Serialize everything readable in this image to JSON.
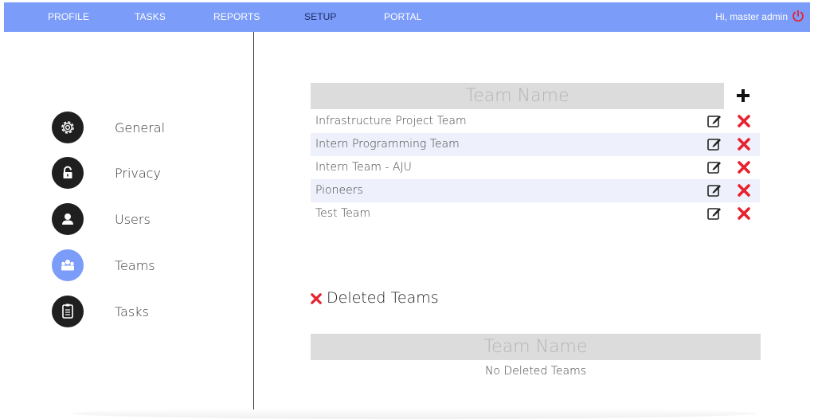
{
  "nav": {
    "items": [
      "PROFILE",
      "TASKS",
      "REPORTS",
      "SETUP",
      "PORTAL"
    ],
    "active": "SETUP",
    "greeting": "Hi, master admin",
    "power_icon": "power-icon",
    "bar_color": "#7b9cf8"
  },
  "sidebar": {
    "items": [
      {
        "label": "General",
        "icon": "gear-icon"
      },
      {
        "label": "Privacy",
        "icon": "lock-icon"
      },
      {
        "label": "Users",
        "icon": "user-icon"
      },
      {
        "label": "Teams",
        "icon": "team-icon"
      },
      {
        "label": "Tasks",
        "icon": "clipboard-icon"
      }
    ],
    "active": "Teams"
  },
  "teams": {
    "header": "Team Name",
    "rows": [
      "Infrastructure Project Team",
      "Intern Programming Team",
      "Intern Team - AJU",
      "Pioneers",
      "Test Team"
    ]
  },
  "deleted": {
    "heading": "Deleted Teams",
    "header": "Team Name",
    "empty_message": "No Deleted Teams"
  },
  "colors": {
    "delete": "#e8212e",
    "accent": "#7b9cf8"
  }
}
